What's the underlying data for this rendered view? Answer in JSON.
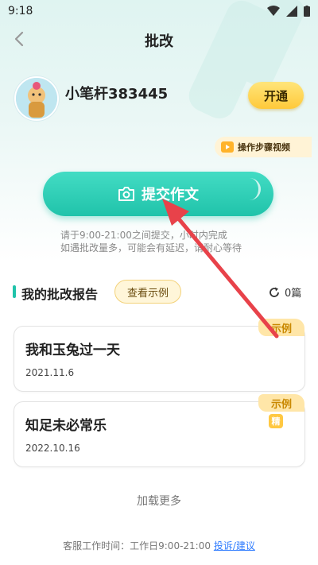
{
  "status_bar": {
    "time": "9:18"
  },
  "header": {
    "title": "批改"
  },
  "user": {
    "name": "小笔杆383445",
    "open_label": "开通"
  },
  "video": {
    "label": "操作步骤视频"
  },
  "submit": {
    "label": "提交作文"
  },
  "hint": {
    "line1": "请于9:00-21:00之间提交，小时内完成",
    "line2": "如遇批改量多，可能会有延迟，请耐心等待"
  },
  "reports": {
    "title": "我的批改报告",
    "example_label": "查看示例",
    "count": "0篇",
    "items": [
      {
        "title": "我和玉兔过一天",
        "date": "2021.11.6",
        "tag": "示例"
      },
      {
        "title": "知足未必常乐",
        "date": "2022.10.16",
        "tag": "示例",
        "badge": "精"
      }
    ]
  },
  "load_more": "加载更多",
  "footer": {
    "hours": "客服工作时间：工作日9:00-21:00",
    "feedback": "投诉/建议"
  },
  "colors": {
    "accent": "#20c3aa",
    "gold": "#ffc93a",
    "link": "#2f7cff",
    "arrow": "#e8424a"
  }
}
